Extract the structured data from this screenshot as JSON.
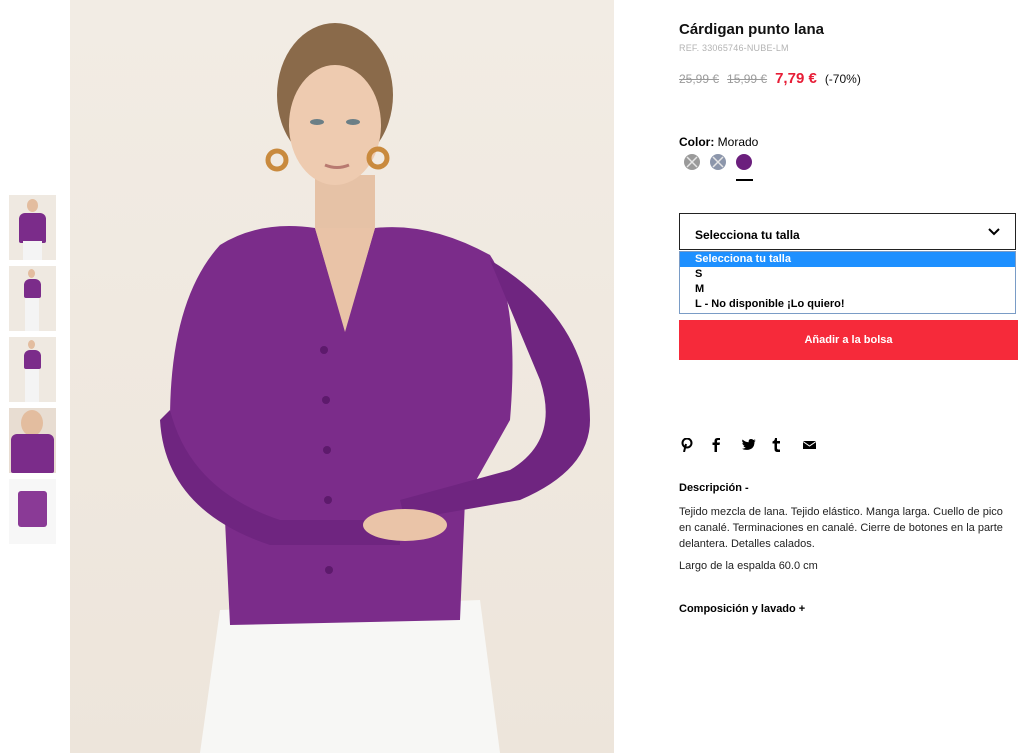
{
  "product": {
    "title": "Cárdigan punto lana",
    "ref": "REF. 33065746-NUBE-LM",
    "price_original": "25,99 €",
    "price_previous": "15,99 €",
    "price_current": "7,79 €",
    "discount": "(-70%)"
  },
  "color": {
    "label": "Color:",
    "value": "Morado",
    "swatches": [
      {
        "name": "grey",
        "color": "#9a9a9a",
        "available": false
      },
      {
        "name": "blue-grey",
        "color": "#8c96ab",
        "available": false
      },
      {
        "name": "purple",
        "color": "#6b1f7d",
        "available": true,
        "selected": true
      }
    ]
  },
  "size": {
    "selected": "Selecciona tu talla",
    "options": [
      "Selecciona tu talla",
      "S",
      "M",
      "L - No disponible ¡Lo quiero!"
    ]
  },
  "cart": {
    "add_label": "Añadir a la bolsa"
  },
  "share": {
    "icons": [
      "pinterest-icon",
      "facebook-icon",
      "twitter-icon",
      "tumblr-icon",
      "email-icon"
    ]
  },
  "description": {
    "heading": "Descripción -",
    "text": "Tejido mezcla de lana. Tejido elástico. Manga larga. Cuello de pico en canalé. Terminaciones en canalé. Cierre de botones en la parte delantera. Detalles calados.",
    "length": "Largo de la espalda 60.0 cm"
  },
  "composition": {
    "heading": "Composición y lavado +"
  },
  "colors": {
    "accent_red": "#e71d36",
    "button_red": "#f62a3a",
    "option_highlight": "#1e90ff",
    "garment_purple": "#7b2c8a"
  }
}
